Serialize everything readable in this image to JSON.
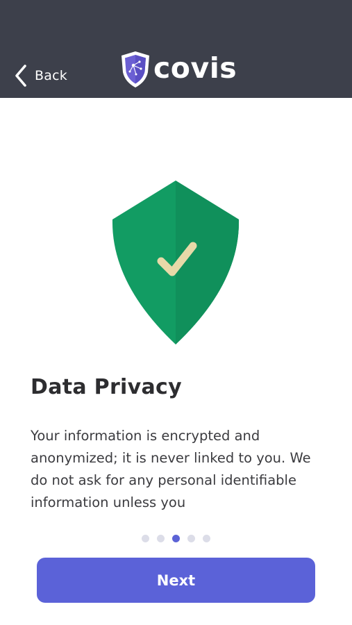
{
  "header": {
    "back_label": "Back",
    "logo_text": "covis",
    "background_color": "#3d404b"
  },
  "illustration": {
    "icon": "shield-check-icon",
    "shield_color": "#129c63",
    "shield_shade_color": "#10905b",
    "check_color": "#e7d9a8"
  },
  "content": {
    "title": "Data Privacy",
    "body": "Your information is encrypted and anonymized; it is never linked to you. We do not ask for any personal identifiable information unless you"
  },
  "pagination": {
    "total": 5,
    "active_index": 2
  },
  "footer": {
    "next_label": "Next",
    "accent_color": "#5b62d8"
  }
}
